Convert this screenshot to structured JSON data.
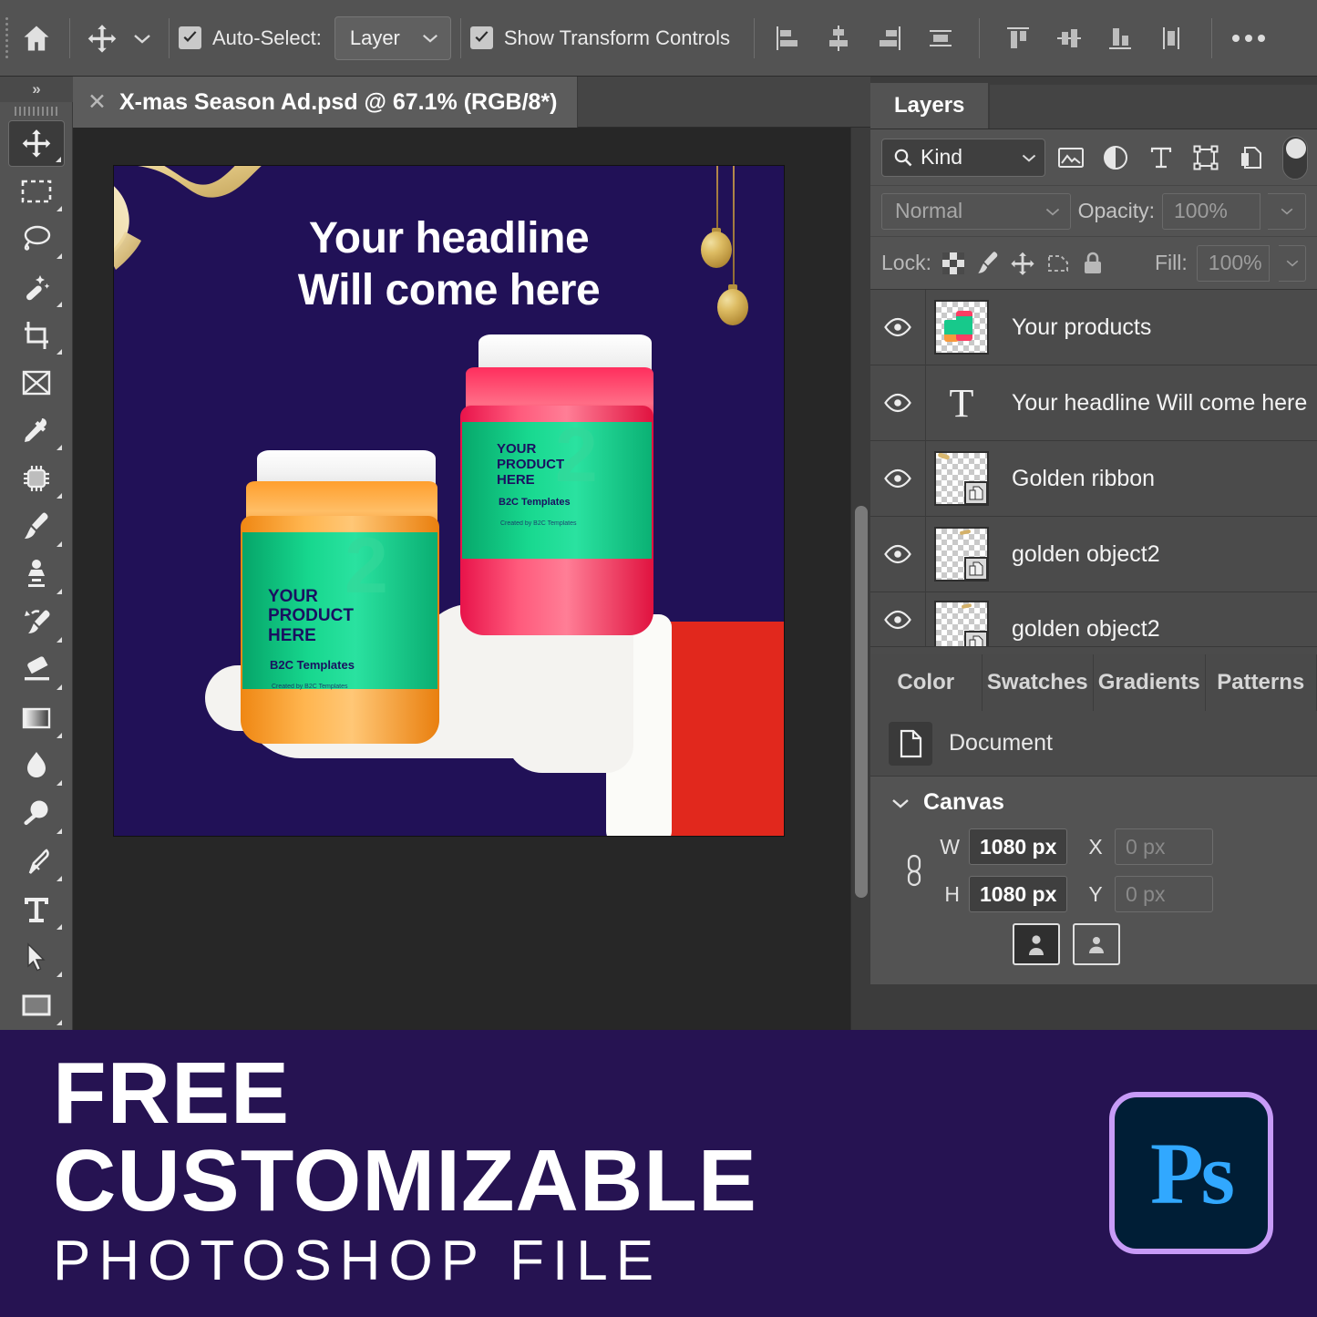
{
  "options_bar": {
    "home_icon": "home-icon",
    "tool_icon": "move-tool-icon",
    "tool_dropdown_icon": "chevron-down-icon",
    "auto_select": {
      "label": "Auto-Select:",
      "checked": true,
      "value": "Layer"
    },
    "show_transform": {
      "label": "Show Transform Controls",
      "checked": true
    },
    "align_buttons": [
      "align-left-edges-icon",
      "align-horizontal-centers-icon",
      "align-right-edges-icon",
      "distribute-horizontally-icon",
      "align-top-edges-icon",
      "align-vertical-centers-icon",
      "align-bottom-edges-icon",
      "distribute-vertically-icon"
    ],
    "overflow_label": "•••"
  },
  "tool_rail": {
    "collapse_label": "»",
    "tools": [
      {
        "name": "move-tool",
        "icon": "move-tool-icon",
        "active": true,
        "has_flyout": true
      },
      {
        "name": "rectangular-marquee-tool",
        "icon": "marquee-icon",
        "active": false,
        "has_flyout": true
      },
      {
        "name": "lasso-tool",
        "icon": "lasso-icon",
        "active": false,
        "has_flyout": true
      },
      {
        "name": "object-selection-tool",
        "icon": "magic-wand-icon",
        "active": false,
        "has_flyout": true
      },
      {
        "name": "crop-tool",
        "icon": "crop-icon",
        "active": false,
        "has_flyout": true
      },
      {
        "name": "frame-tool",
        "icon": "frame-icon",
        "active": false,
        "has_flyout": false
      },
      {
        "name": "eyedropper-tool",
        "icon": "eyedropper-icon",
        "active": false,
        "has_flyout": true
      },
      {
        "name": "spot-healing-brush-tool",
        "icon": "healing-patch-icon",
        "active": false,
        "has_flyout": true
      },
      {
        "name": "brush-tool",
        "icon": "brush-icon",
        "active": false,
        "has_flyout": true
      },
      {
        "name": "clone-stamp-tool",
        "icon": "clone-stamp-icon",
        "active": false,
        "has_flyout": true
      },
      {
        "name": "history-brush-tool",
        "icon": "history-brush-icon",
        "active": false,
        "has_flyout": true
      },
      {
        "name": "eraser-tool",
        "icon": "eraser-icon",
        "active": false,
        "has_flyout": true
      },
      {
        "name": "gradient-tool",
        "icon": "gradient-icon",
        "active": false,
        "has_flyout": true
      },
      {
        "name": "blur-tool",
        "icon": "blur-drop-icon",
        "active": false,
        "has_flyout": true
      },
      {
        "name": "dodge-tool",
        "icon": "dodge-icon",
        "active": false,
        "has_flyout": true
      },
      {
        "name": "pen-tool",
        "icon": "pen-icon",
        "active": false,
        "has_flyout": true
      },
      {
        "name": "horizontal-type-tool",
        "icon": "type-tool-icon",
        "active": false,
        "has_flyout": true
      },
      {
        "name": "path-selection-tool",
        "icon": "path-arrow-icon",
        "active": false,
        "has_flyout": true
      },
      {
        "name": "rectangle-tool",
        "icon": "rectangle-shape-icon",
        "active": false,
        "has_flyout": true
      }
    ]
  },
  "document_tab": {
    "close_icon": "close-icon",
    "title": "X-mas Season Ad.psd @ 67.1% (RGB/8*)"
  },
  "artboard": {
    "background_color": "#211157",
    "headline_line1": "Your headline",
    "headline_line2": "Will come here",
    "headline_color": "#ffffff",
    "ornaments": [
      "gold-ornament-1",
      "gold-ornament-2"
    ],
    "ribbon": "golden-ribbon",
    "jars": [
      {
        "name": "product-jar-orange",
        "cap_color": "#f2f2f2",
        "body_color": "#f79a3c",
        "label_color": "#18c884",
        "label_line1": "YOUR",
        "label_line2": "PRODUCT",
        "label_line3": "HERE",
        "brand": "B2C Templates",
        "fine_print": "Created by B2C Templates",
        "watermark": "2"
      },
      {
        "name": "product-jar-pink",
        "cap_color": "#f2f2f2",
        "body_color": "#fc3e63",
        "label_color": "#18c884",
        "label_line1": "YOUR",
        "label_line2": "PRODUCT",
        "label_line3": "HERE",
        "brand": "B2C Templates",
        "fine_print": "Created by B2C Templates",
        "watermark": "2"
      }
    ],
    "santa_hand": {
      "glove_color": "#f4f3f0",
      "sleeve_color": "#e1281d"
    }
  },
  "layers_panel": {
    "tab_label": "Layers",
    "filter": {
      "icon": "search-icon",
      "value": "Kind",
      "dropdown_icon": "chevron-down-icon"
    },
    "filter_buttons": [
      "pixel-layer-filter-icon",
      "adjustment-layer-filter-icon",
      "type-layer-filter-icon",
      "shape-layer-filter-icon",
      "smart-object-filter-icon"
    ],
    "filter_toggle": "filter-enable-toggle",
    "blend_mode": "Normal",
    "opacity_label": "Opacity:",
    "opacity_value": "100%",
    "lock_label": "Lock:",
    "lock_buttons": [
      "lock-transparent-pixels-icon",
      "lock-image-pixels-icon",
      "lock-position-icon",
      "prevent-artboard-nesting-icon",
      "lock-all-icon"
    ],
    "fill_label": "Fill:",
    "fill_value": "100%",
    "layers": [
      {
        "name": "Your products",
        "visible": true,
        "type": "image",
        "thumb": "product-jars-thumb"
      },
      {
        "name": "Your headline Will come here",
        "visible": true,
        "type": "text",
        "thumb": "type-layer-icon"
      },
      {
        "name": "Golden ribbon",
        "visible": true,
        "type": "smart-object",
        "thumb": "golden-ribbon-thumb"
      },
      {
        "name": "golden object2",
        "visible": true,
        "type": "smart-object",
        "thumb": "golden-object-thumb"
      },
      {
        "name": "golden object2",
        "visible": true,
        "type": "smart-object",
        "thumb": "golden-object-thumb"
      }
    ]
  },
  "properties_panel": {
    "tabs": [
      "Color",
      "Swatches",
      "Gradients",
      "Patterns"
    ],
    "doc_icon": "document-icon",
    "doc_label": "Document",
    "section": {
      "title": "Canvas",
      "collapse_icon": "chevron-down-icon"
    },
    "link_icon": "link-dimensions-icon",
    "fields": {
      "w_label": "W",
      "w_value": "1080 px",
      "h_label": "H",
      "h_value": "1080 px",
      "x_label": "X",
      "x_value": "0 px",
      "y_label": "Y",
      "y_value": "0 px"
    },
    "orientation": [
      {
        "name": "portrait-orientation-button",
        "selected": true
      },
      {
        "name": "landscape-orientation-button",
        "selected": false
      }
    ]
  },
  "banner": {
    "line1": "FREE",
    "line2": "CUSTOMIZABLE",
    "line3": "PHOTOSHOP FILE",
    "badge_label": "Ps",
    "background_color": "#261352",
    "badge_border_color": "#c79bf7",
    "badge_text_color": "#31a8ff"
  }
}
